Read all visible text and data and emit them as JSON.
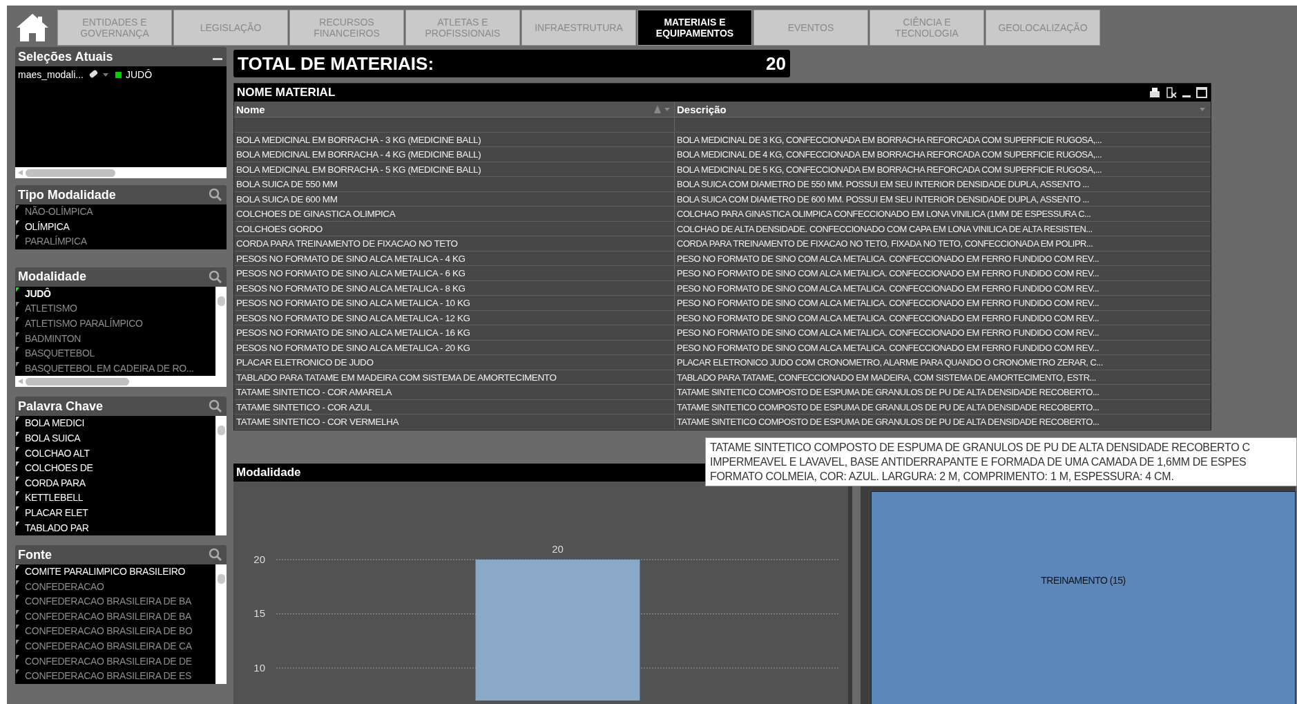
{
  "tabs": [
    {
      "lines": [
        "ENTIDADES E",
        "GOVERNANÇA"
      ],
      "selected": false
    },
    {
      "lines": [
        "LEGISLAÇÃO"
      ],
      "selected": false
    },
    {
      "lines": [
        "RECURSOS",
        "FINANCEIROS"
      ],
      "selected": false
    },
    {
      "lines": [
        "ATLETAS E",
        "PROFISSIONAIS"
      ],
      "selected": false
    },
    {
      "lines": [
        "INFRAESTRUTURA"
      ],
      "selected": false
    },
    {
      "lines": [
        "MATERIAIS E",
        "EQUIPAMENTOS"
      ],
      "selected": true
    },
    {
      "lines": [
        "EVENTOS"
      ],
      "selected": false
    },
    {
      "lines": [
        "CIÊNCIA E",
        "TECNOLOGIA"
      ],
      "selected": false
    },
    {
      "lines": [
        "GEOLOCALIZAÇÃO"
      ],
      "selected": false
    }
  ],
  "current_selections": {
    "title": "Seleções Atuais",
    "field": "maes_modali...",
    "value": "JUDÔ"
  },
  "list_boxes": [
    {
      "title": "Tipo Modalidade",
      "items": [
        {
          "label": "NÃO-OLÍMPICA",
          "selected": false,
          "excluded": true
        },
        {
          "label": "OLÍMPICA",
          "selected": false,
          "excluded": false
        },
        {
          "label": "PARALÍMPICA",
          "selected": false,
          "excluded": true
        }
      ]
    },
    {
      "title": "Modalidade",
      "items": [
        {
          "label": "JUDÔ",
          "selected": true,
          "excluded": false
        },
        {
          "label": "ATLETISMO",
          "selected": false,
          "excluded": true
        },
        {
          "label": "ATLETISMO PARALÍMPICO",
          "selected": false,
          "excluded": true
        },
        {
          "label": "BADMINTON",
          "selected": false,
          "excluded": true
        },
        {
          "label": "BASQUETEBOL",
          "selected": false,
          "excluded": true
        },
        {
          "label": "BASQUETEBOL EM CADEIRA DE RO...",
          "selected": false,
          "excluded": true
        }
      ]
    },
    {
      "title": "Palavra Chave",
      "items": [
        {
          "label": "BOLA MEDICI",
          "selected": false,
          "excluded": false
        },
        {
          "label": "BOLA SUICA",
          "selected": false,
          "excluded": false
        },
        {
          "label": "COLCHAO ALT",
          "selected": false,
          "excluded": false
        },
        {
          "label": "COLCHOES DE",
          "selected": false,
          "excluded": false
        },
        {
          "label": "CORDA PARA",
          "selected": false,
          "excluded": false
        },
        {
          "label": "KETTLEBELL",
          "selected": false,
          "excluded": false
        },
        {
          "label": "PLACAR ELET",
          "selected": false,
          "excluded": false
        },
        {
          "label": "TABLADO PAR",
          "selected": false,
          "excluded": false
        }
      ]
    },
    {
      "title": "Fonte",
      "items": [
        {
          "label": "COMITE PARALIMPICO BRASILEIRO",
          "selected": false,
          "excluded": false
        },
        {
          "label": "CONFEDERACAO",
          "selected": false,
          "excluded": true
        },
        {
          "label": "CONFEDERACAO BRASILEIRA DE BA",
          "selected": false,
          "excluded": true
        },
        {
          "label": "CONFEDERACAO BRASILEIRA DE BA",
          "selected": false,
          "excluded": true
        },
        {
          "label": "CONFEDERACAO BRASILEIRA DE BO",
          "selected": false,
          "excluded": true
        },
        {
          "label": "CONFEDERACAO BRASILEIRA DE CA",
          "selected": false,
          "excluded": true
        },
        {
          "label": "CONFEDERACAO BRASILEIRA DE DE",
          "selected": false,
          "excluded": true
        },
        {
          "label": "CONFEDERACAO BRASILEIRA DE ES",
          "selected": false,
          "excluded": true
        }
      ]
    }
  ],
  "total": {
    "label": "TOTAL DE MATERIAIS:",
    "value": "20"
  },
  "table": {
    "title": "NOME MATERIAL",
    "columns": [
      "Nome",
      "Descrição"
    ],
    "rows": [
      [
        "BOLA MEDICINAL EM BORRACHA - 3 KG (MEDICINE BALL)",
        "BOLA MEDICINAL DE 3 KG, CONFECCIONADA EM BORRACHA REFORCADA COM SUPERFICIE RUGOSA,..."
      ],
      [
        "BOLA MEDICINAL EM BORRACHA - 4 KG (MEDICINE BALL)",
        "BOLA MEDICINAL DE 4 KG, CONFECCIONADA EM BORRACHA REFORCADA COM SUPERFICIE RUGOSA,..."
      ],
      [
        "BOLA MEDICINAL EM BORRACHA - 5 KG (MEDICINE BALL)",
        "BOLA MEDICINAL DE 5 KG, CONFECCIONADA EM BORRACHA REFORCADA COM SUPERFICIE RUGOSA,..."
      ],
      [
        "BOLA SUICA DE 550 MM",
        "BOLA SUICA COM DIAMETRO DE 550 MM. POSSUI EM SEU INTERIOR DENSIDADE DUPLA, ASSENTO ..."
      ],
      [
        "BOLA SUICA DE 600 MM",
        "BOLA SUICA COM DIAMETRO DE 600 MM. POSSUI EM SEU INTERIOR DENSIDADE DUPLA, ASSENTO ..."
      ],
      [
        "COLCHOES DE GINASTICA OLIMPICA",
        "COLCHAO PARA GINASTICA OLIMPICA CONFECCIONADO EM LONA VINILICA (1MM DE ESPESSURA C..."
      ],
      [
        "COLCHOES GORDO",
        "COLCHAO DE ALTA DENSIDADE. CONFECCIONADO COM CAPA EM LONA VINILICA DE ALTA RESISTEN..."
      ],
      [
        "CORDA PARA TREINAMENTO DE FIXACAO NO TETO",
        "CORDA PARA TREINAMENTO DE FIXACAO NO TETO, FIXADA NO TETO, CONFECCIONADA EM POLIPR..."
      ],
      [
        "PESOS NO FORMATO DE SINO ALCA METALICA - 4 KG",
        "PESO NO FORMATO DE SINO COM ALCA METALICA. CONFECCIONADO EM FERRO FUNDIDO COM REV..."
      ],
      [
        "PESOS NO FORMATO DE SINO ALCA METALICA - 6 KG",
        "PESO NO FORMATO DE SINO COM ALCA METALICA. CONFECCIONADO EM FERRO FUNDIDO COM REV..."
      ],
      [
        "PESOS NO FORMATO DE SINO ALCA METALICA - 8 KG",
        "PESO NO FORMATO DE SINO COM ALCA METALICA. CONFECCIONADO EM FERRO FUNDIDO COM REV..."
      ],
      [
        "PESOS NO FORMATO DE SINO ALCA METALICA - 10 KG",
        "PESO NO FORMATO DE SINO COM ALCA METALICA. CONFECCIONADO EM FERRO FUNDIDO COM REV..."
      ],
      [
        "PESOS NO FORMATO DE SINO ALCA METALICA - 12 KG",
        "PESO NO FORMATO DE SINO COM ALCA METALICA. CONFECCIONADO EM FERRO FUNDIDO COM REV..."
      ],
      [
        "PESOS NO FORMATO DE SINO ALCA METALICA - 16 KG",
        "PESO NO FORMATO DE SINO COM ALCA METALICA. CONFECCIONADO EM FERRO FUNDIDO COM REV..."
      ],
      [
        "PESOS NO FORMATO DE SINO ALCA METALICA - 20 KG",
        "PESO NO FORMATO DE SINO COM ALCA METALICA. CONFECCIONADO EM FERRO FUNDIDO COM REV..."
      ],
      [
        "PLACAR ELETRONICO DE JUDO",
        "PLACAR ELETRONICO JUDO COM CRONOMETRO, ALARME PARA QUANDO O CRONOMETRO ZERAR, C..."
      ],
      [
        "TABLADO PARA TATAME EM MADEIRA COM SISTEMA DE AMORTECIMENTO",
        "TABLADO PARA TATAME, CONFECCIONADO EM MADEIRA, COM SISTEMA DE AMORTECIMENTO, ESTR..."
      ],
      [
        "TATAME SINTETICO - COR AMARELA",
        "TATAME SINTETICO COMPOSTO DE ESPUMA DE GRANULOS DE PU DE ALTA DENSIDADE RECOBERTO..."
      ],
      [
        "TATAME SINTETICO - COR AZUL",
        "TATAME SINTETICO COMPOSTO DE ESPUMA DE GRANULOS DE PU DE ALTA DENSIDADE RECOBERTO..."
      ],
      [
        "TATAME SINTETICO - COR VERMELHA",
        "TATAME SINTETICO COMPOSTO DE ESPUMA DE GRANULOS DE PU DE ALTA DENSIDADE RECOBERTO..."
      ]
    ]
  },
  "tooltip": {
    "lines": [
      "TATAME SINTETICO COMPOSTO DE ESPUMA DE GRANULOS DE PU DE ALTA DENSIDADE RECOBERTO C",
      "IMPERMEAVEL E LAVAVEL, BASE ANTIDERRAPANTE E FORMADA DE UMA CAMADA DE 1,6MM DE ESPES",
      "FORMATO COLMEIA, COR: AZUL. LARGURA: 2 M, COMPRIMENTO: 1 M, ESPESSURA: 4 CM."
    ]
  },
  "chart_panel": {
    "title": "Modalidade",
    "chart_data": {
      "type": "bar",
      "values": [
        20
      ],
      "ylim": [
        7,
        20
      ],
      "grid": true,
      "yticks": [
        10,
        15,
        20
      ],
      "data_labels": true
    }
  },
  "treemap": {
    "tiles": [
      {
        "label": "TREINAMENTO (15)"
      }
    ]
  }
}
